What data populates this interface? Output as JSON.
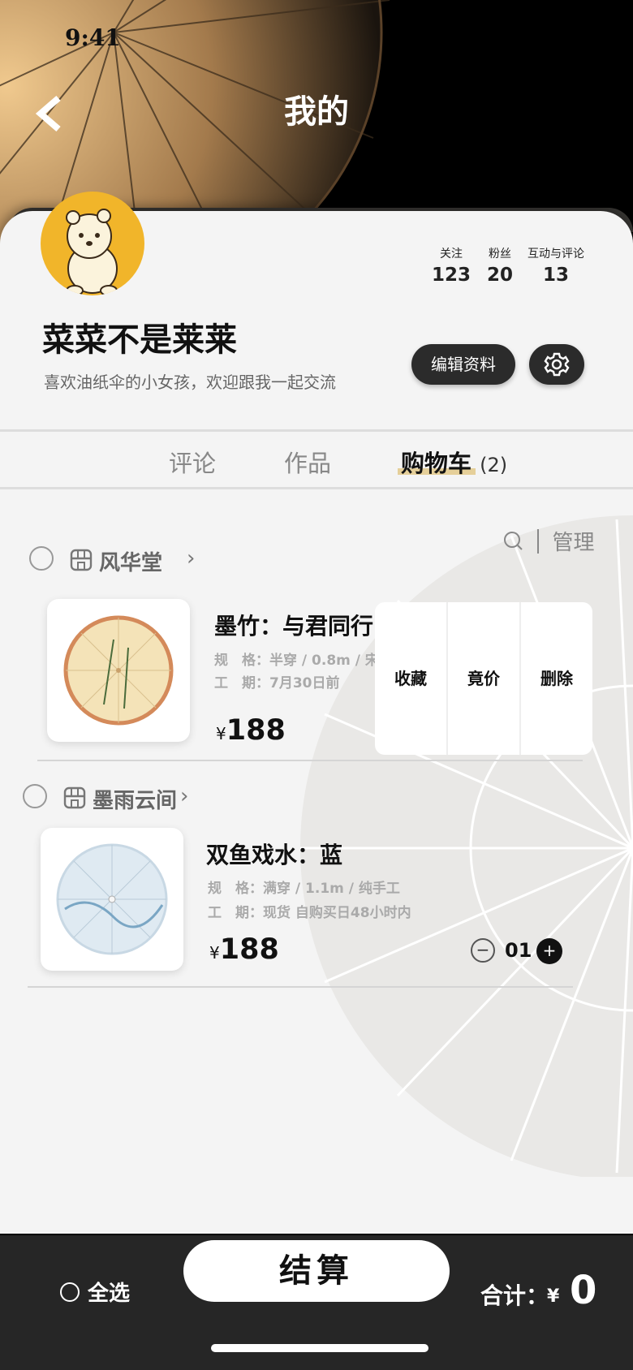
{
  "status_bar": {
    "time": "9:41"
  },
  "header": {
    "title": "我的"
  },
  "profile": {
    "stats": [
      {
        "label": "关注",
        "value": "123"
      },
      {
        "label": "粉丝",
        "value": "20"
      },
      {
        "label": "互动与评论",
        "value": "13"
      }
    ],
    "username": "菜菜不是莱莱",
    "bio": "喜欢油纸伞的小女孩，欢迎跟我一起交流",
    "edit_label": "编辑资料"
  },
  "tabs": {
    "items": [
      {
        "label": "评论"
      },
      {
        "label": "作品"
      },
      {
        "label": "购物车"
      }
    ],
    "cart_count": "(2)",
    "active": "购物车"
  },
  "cart": {
    "manage_label": "管理",
    "currency": "¥",
    "shops": [
      {
        "name": "风华堂",
        "product": {
          "title": "墨竹：与君同行",
          "spec": "规　格：半穿 / 0.8m  / 宋",
          "period": "工　期：7月30日前",
          "price": "188"
        },
        "actions": [
          "收藏",
          "竟价",
          "删除"
        ]
      },
      {
        "name": "墨雨云间",
        "product": {
          "title": "双鱼戏水：蓝",
          "spec": "规　格：满穿 / 1.1m  / 纯手工",
          "period": "工　期：现货 自购买日48小时内",
          "price": "188",
          "quantity": "01"
        }
      }
    ]
  },
  "bottom_bar": {
    "select_all": "全选",
    "checkout": "结算",
    "total_label": "合计：",
    "total_currency": "¥",
    "total_value": "0"
  },
  "colors": {
    "accent_underline": "#e5cf99",
    "dark": "#262626",
    "avatar_bg": "#f1b52a"
  }
}
